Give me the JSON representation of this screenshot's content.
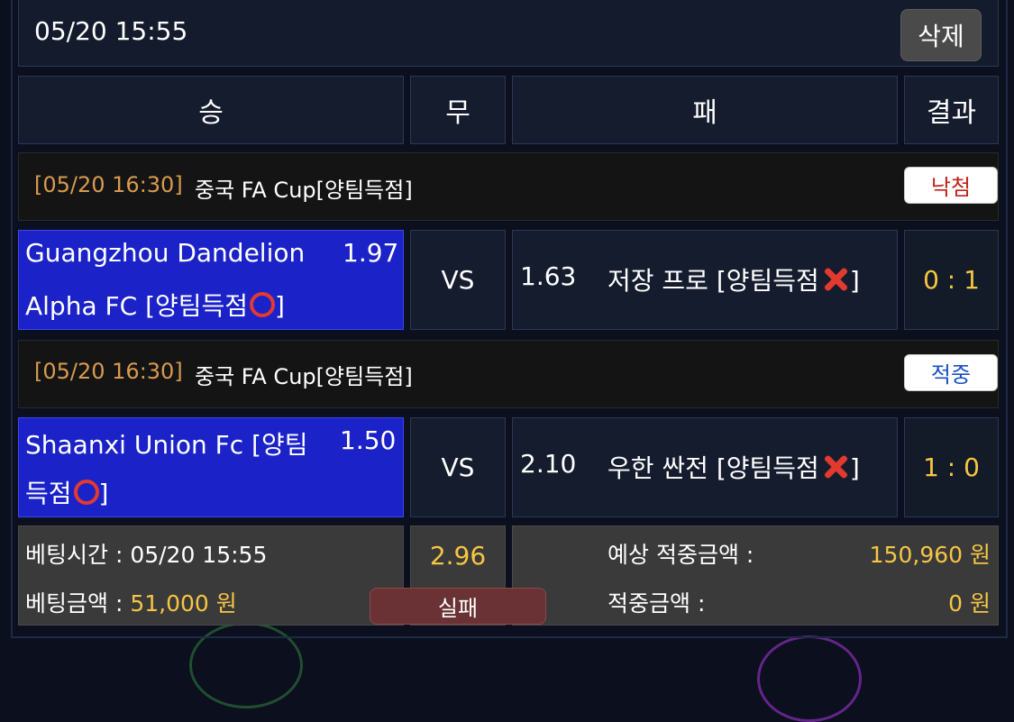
{
  "header": {
    "datetime": "05/20 15:55",
    "delete_label": "삭제"
  },
  "columns": {
    "win": "승",
    "draw": "무",
    "lose": "패",
    "result": "결과"
  },
  "games": [
    {
      "time": "[05/20 16:30]",
      "league": "중국 FA Cup[양팀득점]",
      "status": "낙첨",
      "home_line1": "Guangzhou Dandelion",
      "home_odds": "1.97",
      "home_line2": "Alpha FC [양팀득점",
      "home_line2_end": "]",
      "home_mark": "circle-icon",
      "vs": "VS",
      "away_odds": "1.63",
      "away_name": "저장 프로 [양팀득점",
      "away_end": "]",
      "away_mark": "cross-icon",
      "score": "0 : 1"
    },
    {
      "time": "[05/20 16:30]",
      "league": "중국 FA Cup[양팀득점]",
      "status": "적중",
      "home_line1": "Shaanxi Union Fc [양팀",
      "home_odds": "1.50",
      "home_line2": "득점",
      "home_line2_end": "]",
      "home_mark": "circle-icon",
      "vs": "VS",
      "away_odds": "2.10",
      "away_name": "우한 싼전 [양팀득점",
      "away_end": "]",
      "away_mark": "cross-icon",
      "score": "1 : 0"
    }
  ],
  "summary": {
    "bet_time_label": "베팅시간 : 05/20 15:55",
    "bet_amount_label": "베팅금액 : ",
    "bet_amount_value": "51,000 원",
    "total_odds": "2.96",
    "status_label": "실패",
    "expected_label": "예상 적중금액 :",
    "expected_value": "150,960 원",
    "win_label": "적중금액 :",
    "win_value": "0 원"
  },
  "colors": {
    "background": "#0b0f1e",
    "cell": "#151c2e",
    "team_highlight": "#1b22c8",
    "gold": "#f6c643",
    "orange_time": "#d99a4e",
    "lose_red": "#c0221a",
    "win_blue": "#1a4fc4"
  }
}
